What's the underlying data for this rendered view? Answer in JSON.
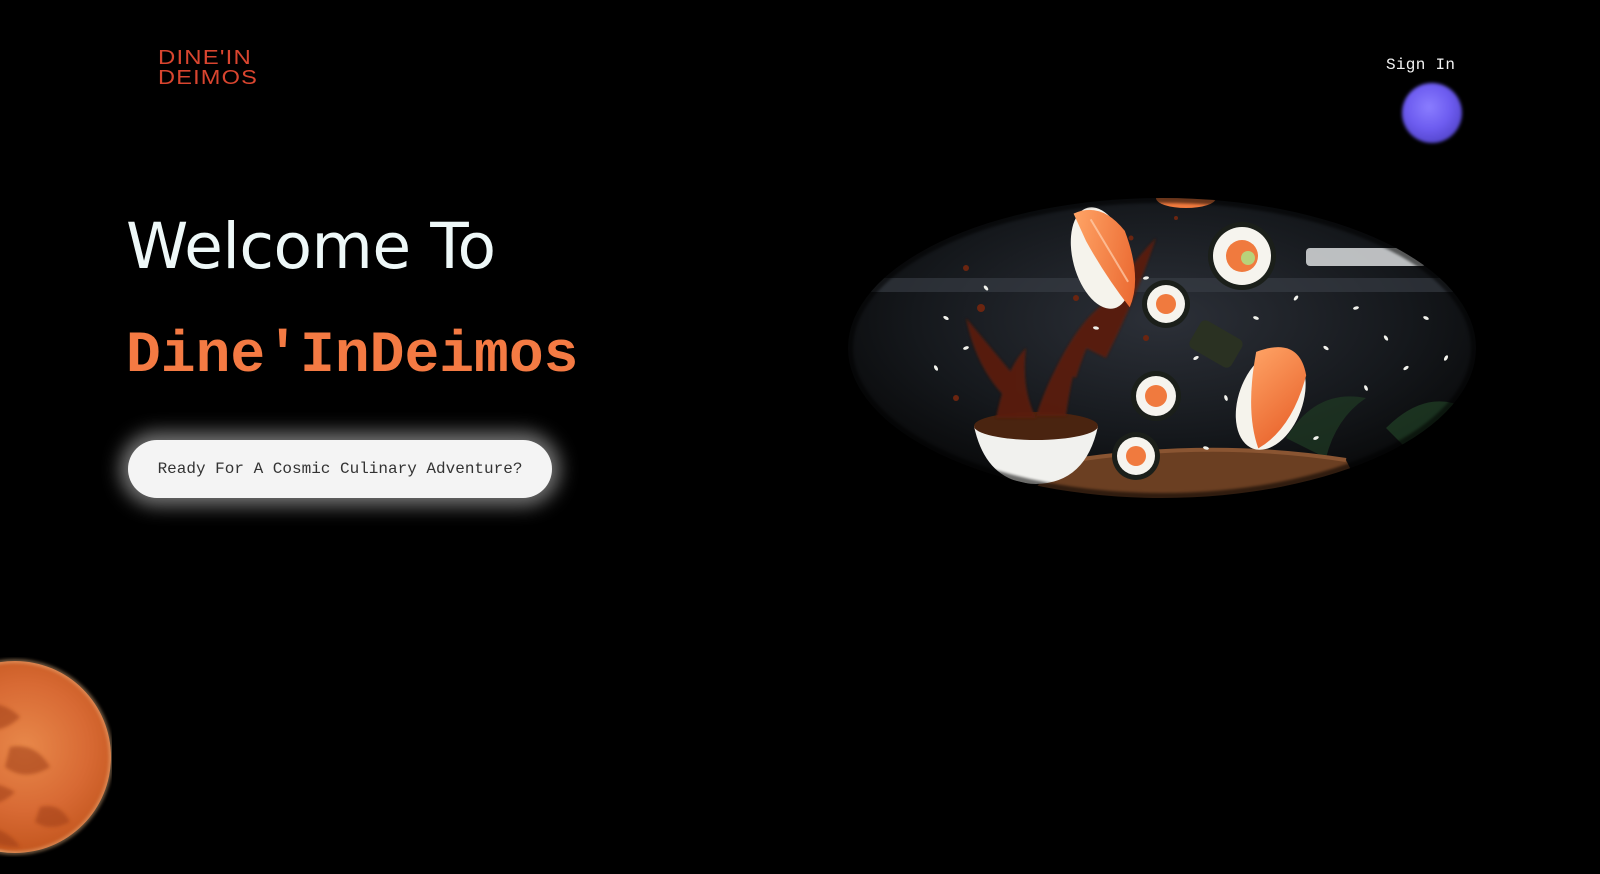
{
  "header": {
    "logo_line1": "DINE'IN",
    "logo_line2": "DEIMOS",
    "sign_in_label": "Sign In"
  },
  "hero": {
    "welcome_text": "Welcome To",
    "brand_name": "Dine'InDeimos",
    "cta_label": "Ready For A Cosmic Culinary Adventure?"
  },
  "colors": {
    "background": "#000000",
    "brand_orange": "#f47a43",
    "logo_red": "#d9452f",
    "welcome_text": "#eef8f8",
    "orb_purple": "#6d5cf0",
    "cta_background": "#f4f4f4"
  },
  "decor": {
    "hero_image_icon": "sushi-image",
    "planet_icon": "mars-planet",
    "orb_icon": "purple-orb"
  }
}
